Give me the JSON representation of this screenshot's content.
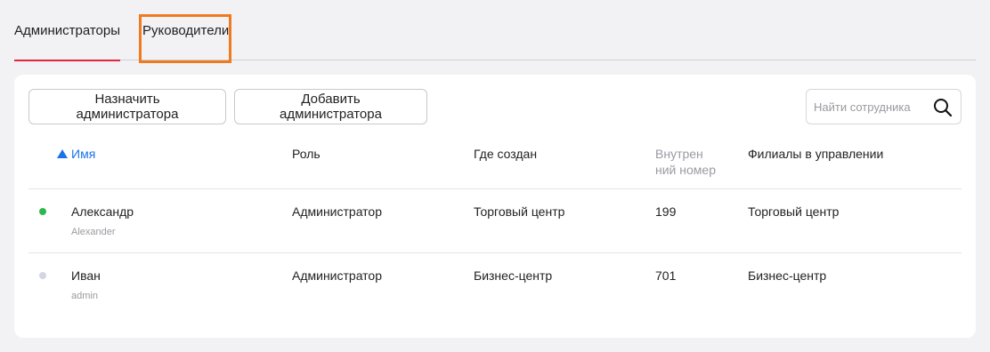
{
  "tabs": [
    {
      "label": "Администраторы",
      "active": true
    },
    {
      "label": "Руководители",
      "active": false
    }
  ],
  "toolbar": {
    "assign_label": "Назначить администратора",
    "add_label": "Добавить администратора",
    "search_placeholder": "Найти сотрудника"
  },
  "table": {
    "columns": {
      "name": "Имя",
      "role": "Роль",
      "created": "Где создан",
      "ext": "Внутрен ний номер",
      "branches": "Филиалы в управлении"
    },
    "sort": {
      "column": "name",
      "direction": "asc"
    },
    "rows": [
      {
        "name": "Александр",
        "login": "Alexander",
        "role": "Администратор",
        "created": "Торговый центр",
        "ext": "199",
        "branches": "Торговый центр",
        "status_color": "#2db84d"
      },
      {
        "name": "Иван",
        "login": "admin",
        "role": "Администратор",
        "created": "Бизнес-центр",
        "ext": "701",
        "branches": "Бизнес-центр",
        "status_color": "#d3d6e2"
      }
    ]
  },
  "colors": {
    "accent": "#e3243b",
    "link": "#1a73e8",
    "highlight": "#f07a1e"
  },
  "icons": {
    "search": "search-icon",
    "sort": "sort-ascending-icon"
  }
}
